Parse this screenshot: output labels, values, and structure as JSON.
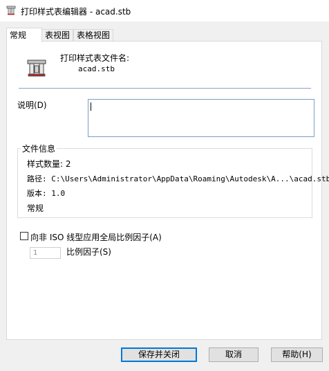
{
  "window": {
    "title": "打印样式表编辑器 - acad.stb"
  },
  "tabs": [
    {
      "label": "常规"
    },
    {
      "label": "表视图"
    },
    {
      "label": "表格视图"
    }
  ],
  "general": {
    "filename_label": "打印样式表文件名:",
    "filename_value": "acad.stb",
    "description_label": "说明(D)",
    "description_value": ""
  },
  "file_info": {
    "title": "文件信息",
    "style_count": "样式数量: 2",
    "path": "路径: C:\\Users\\Administrator\\AppData\\Roaming\\Autodesk\\A...\\acad.stb",
    "version": "版本: 1.0",
    "type": "常规"
  },
  "scale": {
    "checkbox_label": "向非 ISO 线型应用全局比例因子(A)",
    "checked": false,
    "factor_value": "1",
    "factor_label": "比例因子(S)"
  },
  "buttons": {
    "save_close": "保存并关闭",
    "cancel": "取消",
    "help": "帮助(H)"
  }
}
